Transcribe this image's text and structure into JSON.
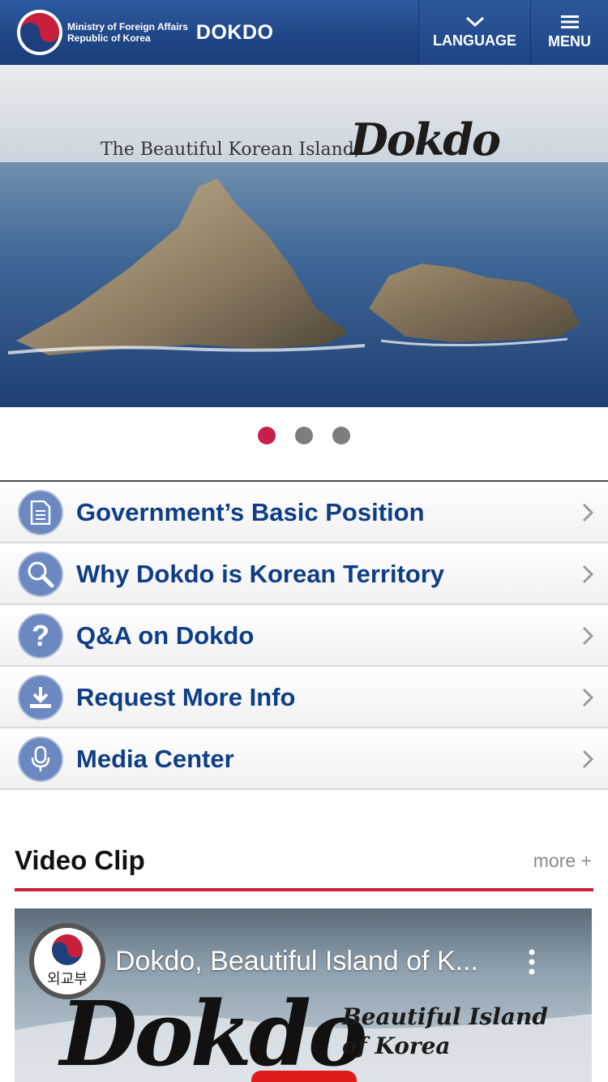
{
  "header": {
    "ministry_line1": "Ministry of Foreign Affairs",
    "ministry_line2": "Republic of Korea",
    "site_name": "DOKDO",
    "language_label": "LANGUAGE",
    "menu_label": "MENU",
    "bg_color": "#1f4686"
  },
  "hero": {
    "title": "The Beautiful Korean Island,",
    "logo_text": "Dokdo",
    "slides_count": 3,
    "active_slide": 1,
    "active_dot_color": "#c8204d"
  },
  "menu": {
    "items": [
      {
        "label": "Government’s Basic Position",
        "icon": "document-icon"
      },
      {
        "label": "Why Dokdo is Korean Territory",
        "icon": "magnifier-icon"
      },
      {
        "label": "Q&A on Dokdo",
        "icon": "question-icon"
      },
      {
        "label": "Request More Info",
        "icon": "download-icon"
      },
      {
        "label": "Media Center",
        "icon": "microphone-icon"
      }
    ],
    "label_color": "#0f3e86"
  },
  "video_clip": {
    "title": "Video Clip",
    "more": "more +",
    "accent_color": "#c8203b",
    "video": {
      "channel": "외교부",
      "title": "Dokdo, Beautiful Island of K...",
      "thumb_big": "Dokdo",
      "thumb_sub1": "Beautiful Island",
      "thumb_sub2": "of Korea"
    }
  }
}
